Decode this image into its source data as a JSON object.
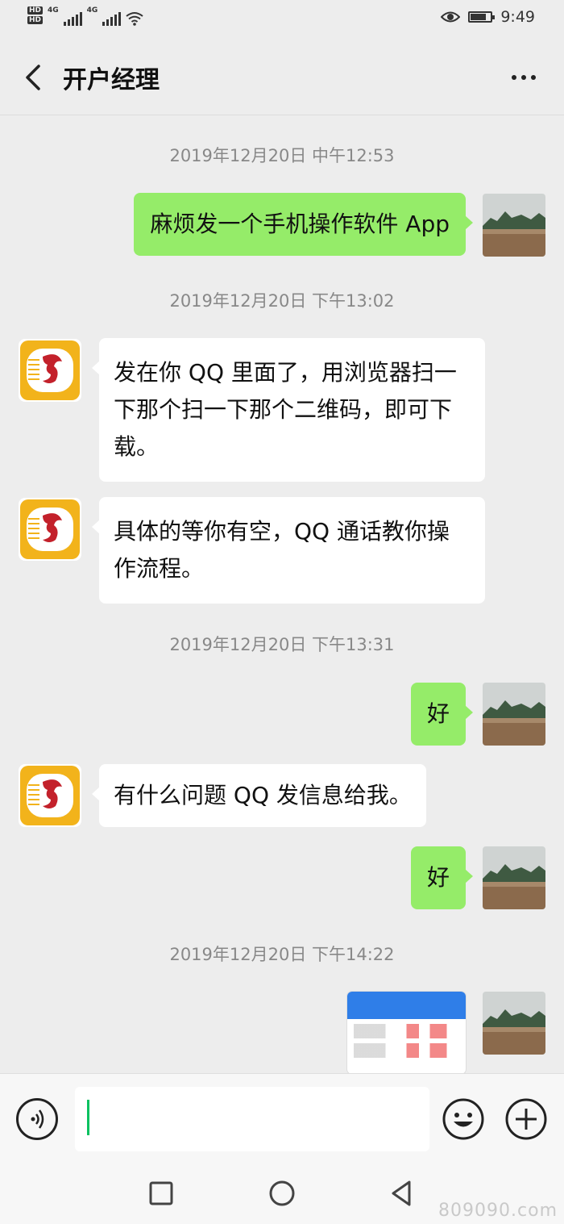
{
  "status_bar": {
    "left_badges": [
      "HD",
      "HD"
    ],
    "network_1": "4G",
    "network_2": "4G",
    "time": "9:49"
  },
  "header": {
    "title": "开户经理",
    "back_icon": "chevron-left-icon",
    "more_icon": "more-dots-icon"
  },
  "messages": [
    {
      "type": "timestamp",
      "text": "2019年12月20日 中午12:53"
    },
    {
      "type": "text",
      "sender": "me",
      "text": "麻烦发一个手机操作软件 App"
    },
    {
      "type": "timestamp",
      "text": "2019年12月20日 下午13:02"
    },
    {
      "type": "text",
      "sender": "other",
      "text": "发在你 QQ 里面了，用浏览器扫一下那个扫一下那个二维码，即可下载。"
    },
    {
      "type": "text",
      "sender": "other",
      "text": "具体的等你有空，QQ 通话教你操作流程。"
    },
    {
      "type": "timestamp",
      "text": "2019年12月20日 下午13:31"
    },
    {
      "type": "text",
      "sender": "me",
      "text": "好"
    },
    {
      "type": "text",
      "sender": "other",
      "text": "有什么问题 QQ 发信息给我。"
    },
    {
      "type": "text",
      "sender": "me",
      "text": "好"
    },
    {
      "type": "timestamp",
      "text": "2019年12月20日 下午14:22"
    },
    {
      "type": "image",
      "sender": "me"
    }
  ],
  "input_bar": {
    "voice_icon": "voice-icon",
    "emoji_icon": "emoji-icon",
    "plus_icon": "plus-icon",
    "input_value": ""
  },
  "nav_bar": {
    "icons": [
      "recent-apps-icon",
      "home-icon",
      "back-triangle-icon"
    ]
  },
  "watermark": "809090.com",
  "colors": {
    "background": "#ededed",
    "my_bubble": "#95ec69",
    "other_bubble": "#ffffff",
    "timestamp": "#888888",
    "caret": "#07c160"
  }
}
